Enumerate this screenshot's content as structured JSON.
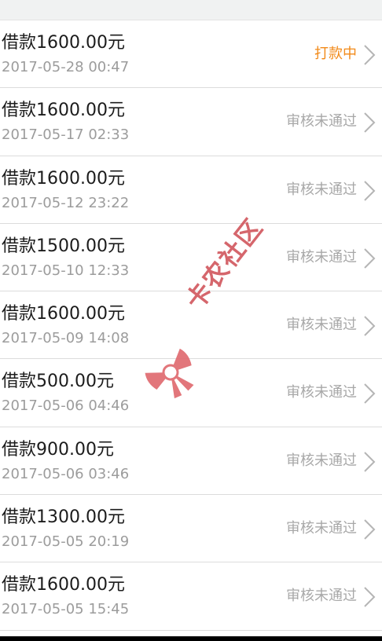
{
  "loans": [
    {
      "title": "借款1600.00元",
      "date": "2017-05-28 00:47",
      "status": "打款中",
      "status_type": "paying"
    },
    {
      "title": "借款1600.00元",
      "date": "2017-05-17 02:33",
      "status": "审核未通过",
      "status_type": "rejected"
    },
    {
      "title": "借款1600.00元",
      "date": "2017-05-12 23:22",
      "status": "审核未通过",
      "status_type": "rejected"
    },
    {
      "title": "借款1500.00元",
      "date": "2017-05-10 12:33",
      "status": "审核未通过",
      "status_type": "rejected"
    },
    {
      "title": "借款1600.00元",
      "date": "2017-05-09 14:08",
      "status": "审核未通过",
      "status_type": "rejected"
    },
    {
      "title": "借款500.00元",
      "date": "2017-05-06 04:46",
      "status": "审核未通过",
      "status_type": "rejected"
    },
    {
      "title": "借款900.00元",
      "date": "2017-05-06 03:46",
      "status": "审核未通过",
      "status_type": "rejected"
    },
    {
      "title": "借款1300.00元",
      "date": "2017-05-05 20:19",
      "status": "审核未通过",
      "status_type": "rejected"
    },
    {
      "title": "借款1600.00元",
      "date": "2017-05-05 15:45",
      "status": "审核未通过",
      "status_type": "rejected"
    }
  ],
  "watermark": {
    "text": "卡农社区",
    "color": "#d25a60"
  },
  "colors": {
    "paying_status": "#f28a19",
    "rejected_status": "#a8a8a8",
    "divider": "#dcdcdc"
  },
  "icons": {
    "row_arrow": "chevron-right-icon",
    "watermark_logo": "bow-logo-icon"
  }
}
